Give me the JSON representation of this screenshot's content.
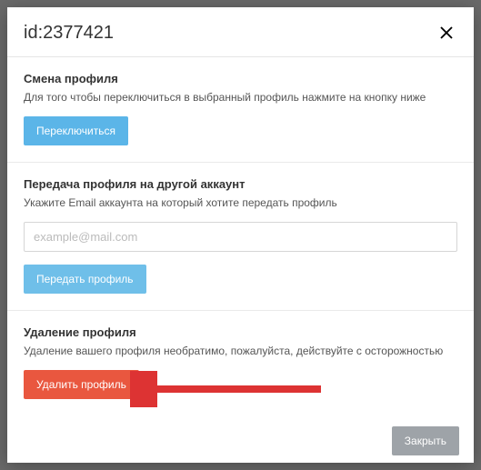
{
  "header": {
    "title": "id:2377421"
  },
  "sections": {
    "switch": {
      "title": "Смена профиля",
      "desc": "Для того чтобы переключиться в выбранный профиль нажмите на кнопку ниже",
      "button": "Переключиться"
    },
    "transfer": {
      "title": "Передача профиля на другой аккаунт",
      "desc": "Укажите Email аккаунта на который хотите передать профиль",
      "placeholder": "example@mail.com",
      "button": "Передать профиль"
    },
    "delete": {
      "title": "Удаление профиля",
      "desc": "Удаление вашего профиля необратимо, пожалуйста, действуйте с осторожностью",
      "button": "Удалить профиль"
    }
  },
  "footer": {
    "close": "Закрыть"
  }
}
